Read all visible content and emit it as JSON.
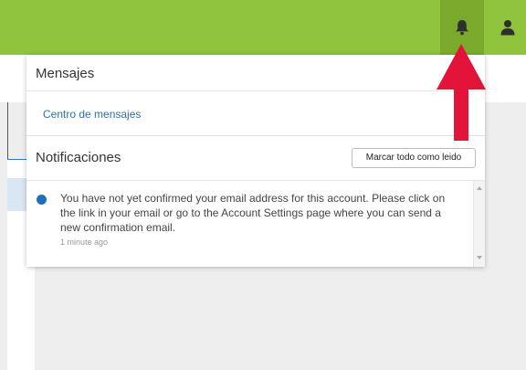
{
  "topbar": {
    "bell_icon": "bell-icon",
    "user_icon": "user-icon",
    "bar_color": "#8fc43c",
    "active_color": "#7aaa2c"
  },
  "messages": {
    "title": "Mensajes",
    "link": "Centro de mensajes"
  },
  "notifications": {
    "title": "Notificaciones",
    "mark_all_label": "Marcar todo como leido",
    "items": [
      {
        "text": "You have not yet confirmed your email address for this account. Please click on the link in your email or go to the Account Settings page where you can send a new confirmation email.",
        "time": "1 minute ago",
        "unread_color": "#1f6fc0"
      }
    ]
  },
  "annotation": {
    "arrow_color": "#e3133a"
  }
}
